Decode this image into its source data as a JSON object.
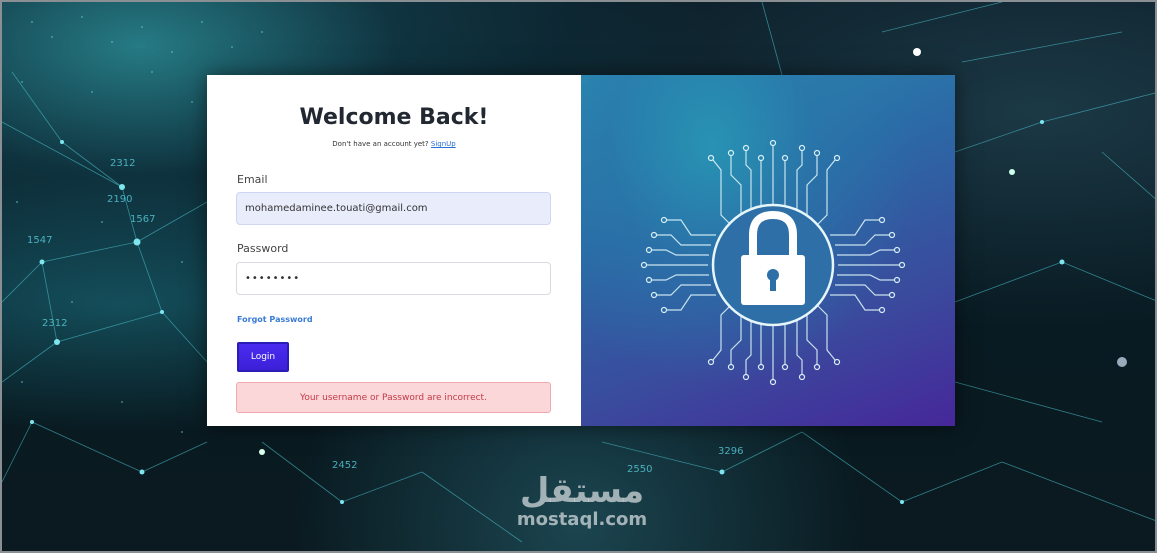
{
  "login": {
    "title": "Welcome Back!",
    "subtitle_prefix": "Don't have an account yet?",
    "signup_link": "SignUp",
    "email_label": "Email",
    "email_value": "mohamedaminee.touati@gmail.com",
    "password_label": "Password",
    "password_value": "••••••••",
    "forgot_link": "Forgot Password",
    "login_button": "Login",
    "error_message": "Your username or Password are incorrect."
  },
  "background": {
    "numbers": [
      "2312",
      "2190",
      "1567",
      "1547",
      "2312",
      "2452",
      "3296",
      "2550"
    ]
  },
  "watermark": {
    "logo": "مستقل",
    "domain": "mostaql.com"
  },
  "colors": {
    "primary_button": "#4a2cf0",
    "link": "#2a6fd6",
    "error_bg": "#fbd7d9",
    "error_text": "#c23a47",
    "email_field_bg": "#e8ecfb"
  }
}
